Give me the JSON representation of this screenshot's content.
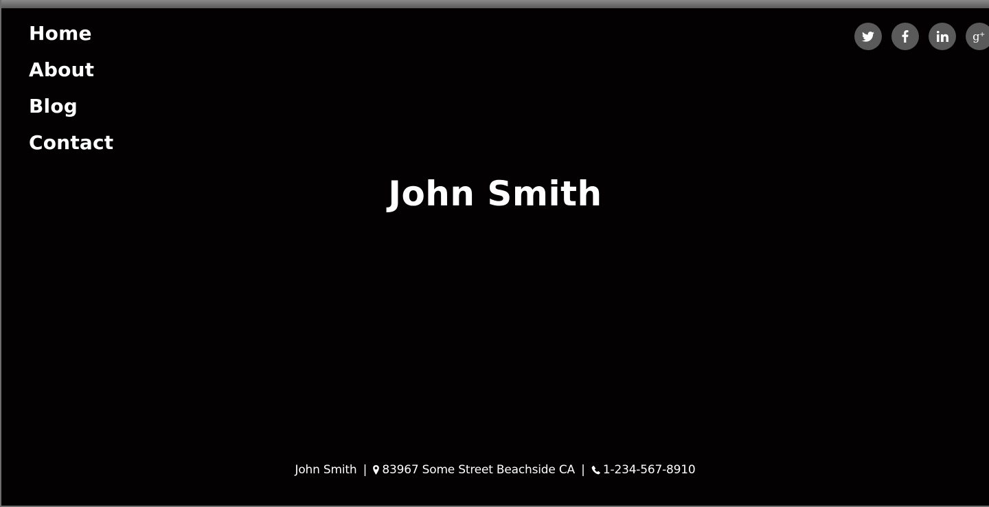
{
  "nav": {
    "items": [
      {
        "label": "Home"
      },
      {
        "label": "About"
      },
      {
        "label": "Blog"
      },
      {
        "label": "Contact"
      }
    ]
  },
  "social": {
    "icons": [
      "twitter-icon",
      "facebook-icon",
      "linkedin-icon",
      "google-plus-icon"
    ],
    "button_color": "#5a5a5a"
  },
  "hero": {
    "title": "John Smith"
  },
  "footer": {
    "name": "John Smith",
    "separator": "|",
    "address": "83967 Some Street Beachside CA",
    "phone": "1-234-567-8910"
  },
  "colors": {
    "background": "#030102",
    "text": "#ffffff"
  }
}
